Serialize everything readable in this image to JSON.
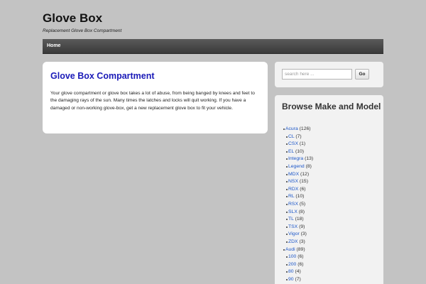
{
  "site": {
    "title": "Glove Box",
    "tagline": "Replacement Glove Box Compartment"
  },
  "nav": {
    "items": [
      {
        "label": "Home"
      }
    ]
  },
  "post": {
    "title": "Glove Box Compartment",
    "body": "Your glove compartment or glove box takes a lot of abuse, from being banged by knees and feet to the damaging rays of the sun. Many times the latches and locks will quit working. If you have a damaged or non-working glove-box, get a new replacement glove box to fit your vehicle."
  },
  "search": {
    "placeholder": "search here ...",
    "button_label": "Go"
  },
  "browse": {
    "title": "Browse Make and Model",
    "makes": [
      {
        "name": "Acura",
        "count": "(126)",
        "models": [
          {
            "name": "CL",
            "count": "(7)"
          },
          {
            "name": "CSX",
            "count": "(1)"
          },
          {
            "name": "EL",
            "count": "(10)"
          },
          {
            "name": "Integra",
            "count": "(13)"
          },
          {
            "name": "Legend",
            "count": "(8)"
          },
          {
            "name": "MDX",
            "count": "(12)"
          },
          {
            "name": "NSX",
            "count": "(15)"
          },
          {
            "name": "RDX",
            "count": "(6)"
          },
          {
            "name": "RL",
            "count": "(10)"
          },
          {
            "name": "RSX",
            "count": "(5)"
          },
          {
            "name": "SLX",
            "count": "(8)"
          },
          {
            "name": "TL",
            "count": "(18)"
          },
          {
            "name": "TSX",
            "count": "(9)"
          },
          {
            "name": "Vigor",
            "count": "(3)"
          },
          {
            "name": "ZDX",
            "count": "(3)"
          }
        ]
      },
      {
        "name": "Audi",
        "count": "(89)",
        "models": [
          {
            "name": "100",
            "count": "(6)"
          },
          {
            "name": "200",
            "count": "(6)"
          },
          {
            "name": "80",
            "count": "(4)"
          },
          {
            "name": "90",
            "count": "(7)"
          }
        ]
      }
    ]
  }
}
